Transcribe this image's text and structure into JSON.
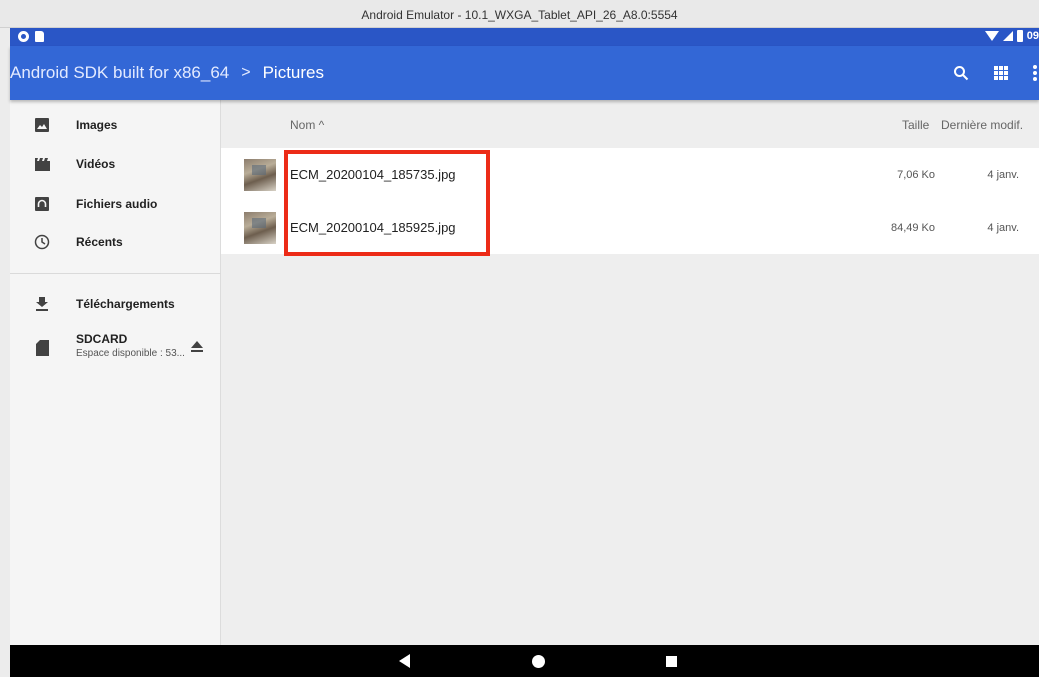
{
  "window": {
    "title": "Android Emulator - 10.1_WXGA_Tablet_API_26_A8.0:5554"
  },
  "status_bar": {
    "time": "09"
  },
  "app_bar": {
    "root": "Android SDK built for x86_64",
    "separator": ">",
    "current": "Pictures",
    "actions": [
      "search-icon",
      "grid-view-icon",
      "more-vert-icon"
    ]
  },
  "drawer": {
    "items": [
      {
        "label": "Images",
        "icon": "image-icon"
      },
      {
        "label": "Vidéos",
        "icon": "video-icon"
      },
      {
        "label": "Fichiers audio",
        "icon": "audio-icon"
      },
      {
        "label": "Récents",
        "icon": "clock-icon"
      },
      {
        "label": "Téléchargements",
        "icon": "download-icon"
      },
      {
        "label": "SDCARD",
        "sub": "Espace disponible : 53...",
        "icon": "sdcard-icon"
      }
    ]
  },
  "columns": {
    "name": "Nom ^",
    "size": "Taille",
    "date": "Dernière modif."
  },
  "files": [
    {
      "name": "ECM_20200104_185735.jpg",
      "size": "7,06 Ko",
      "date": "4 janv."
    },
    {
      "name": "ECM_20200104_185925.jpg",
      "size": "84,49 Ko",
      "date": "4 janv."
    }
  ],
  "colors": {
    "app_bar": "#3367d6",
    "status_bar": "#2a56c6",
    "highlight": "#ec2b17"
  }
}
